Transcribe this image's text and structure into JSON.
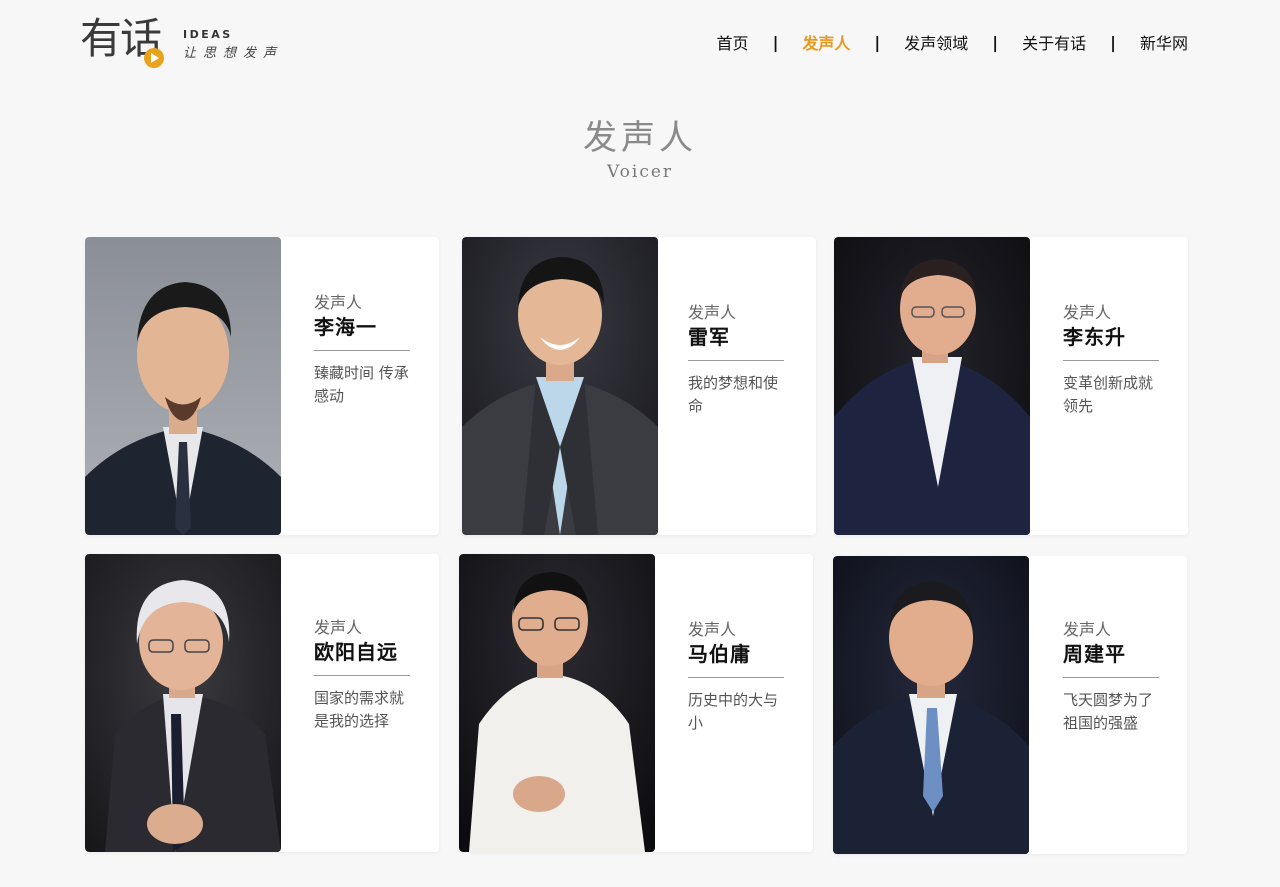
{
  "brand": {
    "logo_text": "有话",
    "logo_en": "IDEAS",
    "logo_tagline": "让思想发声"
  },
  "nav": {
    "items": [
      {
        "label": "首页",
        "active": false
      },
      {
        "label": "发声人",
        "active": true
      },
      {
        "label": "发声领域",
        "active": false
      },
      {
        "label": "关于有话",
        "active": false
      },
      {
        "label": "新华网",
        "active": false
      }
    ],
    "separator": "|"
  },
  "section": {
    "title_cn": "发声人",
    "title_en": "Voicer"
  },
  "cards": [
    {
      "role": "发声人",
      "name": "李海一",
      "desc": "臻藏时间 传承感动"
    },
    {
      "role": "发声人",
      "name": "雷军",
      "desc": "我的梦想和使命"
    },
    {
      "role": "发声人",
      "name": "李东升",
      "desc": "变革创新成就领先"
    },
    {
      "role": "发声人",
      "name": "欧阳自远",
      "desc": "国家的需求就是我的选择"
    },
    {
      "role": "发声人",
      "name": "马伯庸",
      "desc": "历史中的大与小"
    },
    {
      "role": "发声人",
      "name": "周建平",
      "desc": "飞天圆梦为了祖国的强盛"
    }
  ],
  "colors": {
    "accent": "#e89a1e",
    "page_bg": "#f7f7f7",
    "card_bg": "#ffffff"
  }
}
